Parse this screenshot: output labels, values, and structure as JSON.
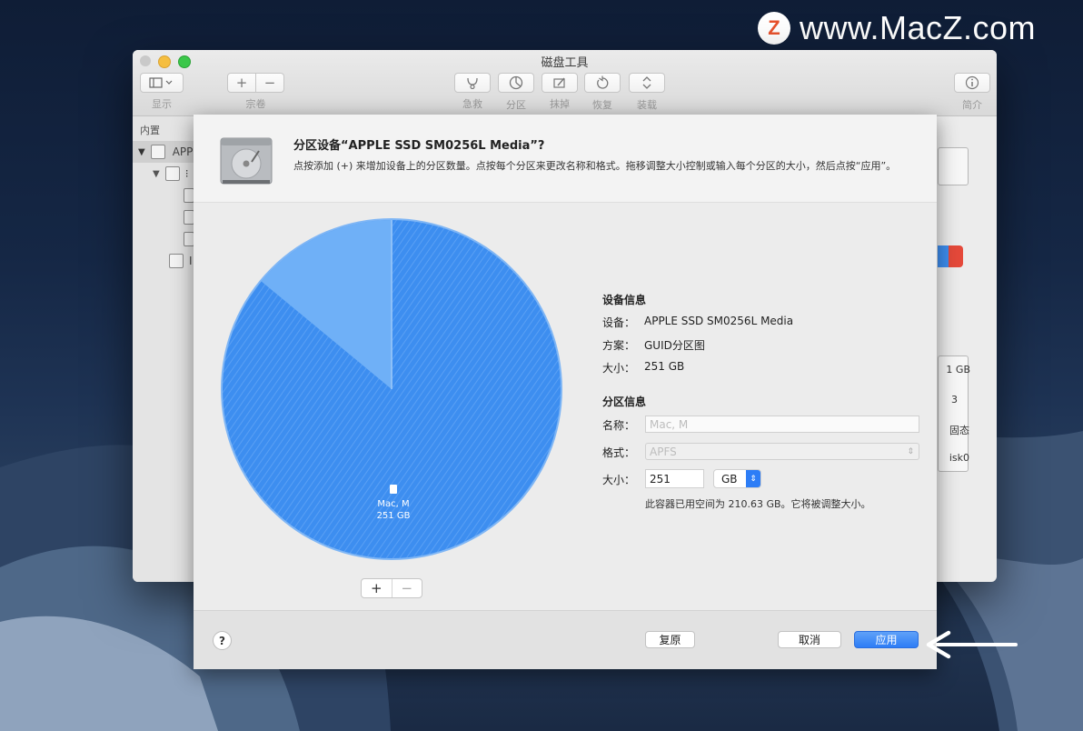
{
  "watermark": {
    "logo_letter": "Z",
    "text": "www.MacZ.com"
  },
  "window": {
    "title": "磁盘工具",
    "toolbar": {
      "view_label": "显示",
      "volume_label": "宗卷",
      "volume_add": "+",
      "volume_remove": "−",
      "rescue_label": "急救",
      "partition_label": "分区",
      "erase_label": "抹掉",
      "restore_label": "恢复",
      "mount_label": "装载",
      "info_label": "简介"
    },
    "sidebar": {
      "header": "内置",
      "items": [
        {
          "label": "APP"
        },
        {
          "label": "⁝"
        },
        {
          "label": ""
        },
        {
          "label": ""
        },
        {
          "label": ""
        },
        {
          "label": "I"
        }
      ]
    },
    "right_values": [
      "1 GB",
      "3",
      "固态",
      "isk0"
    ]
  },
  "sheet": {
    "title": "分区设备“APPLE SSD SM0256L Media”?",
    "description": "点按添加 (+) 来增加设备上的分区数量。点按每个分区来更改名称和格式。拖移调整大小控制或输入每个分区的大小，然后点按“应用”。",
    "pie": {
      "label_name": "Mac, M",
      "label_size": "251 GB",
      "free_fraction": 0.14
    },
    "add_btn": "+",
    "remove_btn": "−",
    "device_info": {
      "heading": "设备信息",
      "device_key": "设备：",
      "device_val": "APPLE SSD SM0256L Media",
      "scheme_key": "方案：",
      "scheme_val": "GUID分区图",
      "size_key": "大小：",
      "size_val": "251 GB"
    },
    "partition_info": {
      "heading": "分区信息",
      "name_key": "名称：",
      "name_val": "Mac, M",
      "format_key": "格式：",
      "format_val": "APFS",
      "size_key": "大小：",
      "size_val": "251",
      "unit": "GB",
      "note": "此容器已用空间为 210.63 GB。它将被调整大小。"
    },
    "footer": {
      "help": "?",
      "revert": "复原",
      "cancel": "取消",
      "apply": "应用"
    }
  },
  "colors": {
    "accent": "#2d7df6",
    "pie_blue": "#3d8ef0",
    "pie_free": "#6fb0f7"
  }
}
